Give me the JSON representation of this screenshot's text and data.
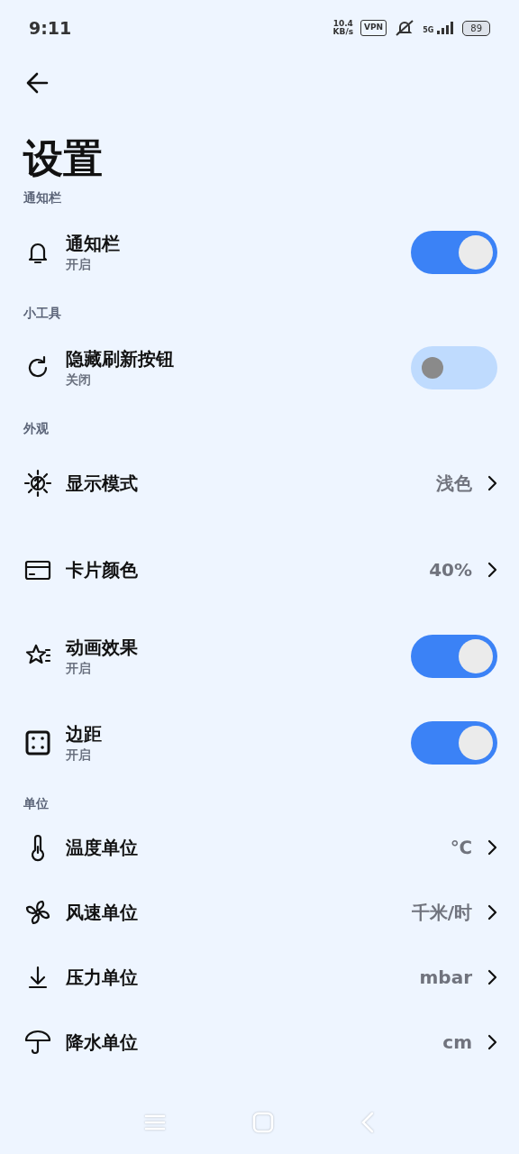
{
  "status_bar": {
    "time": "9:11",
    "net_speed": "10.4",
    "net_unit": "KB/s",
    "vpn": "VPN",
    "network": "5G",
    "battery": "89"
  },
  "title": "设置",
  "sections": [
    {
      "header": "通知栏",
      "items": [
        {
          "kind": "switch",
          "label": "通知栏",
          "sub": "开启",
          "on": true
        }
      ]
    },
    {
      "header": "小工具",
      "items": [
        {
          "kind": "switch",
          "label": "隐藏刷新按钮",
          "sub": "关闭",
          "on": false
        }
      ]
    },
    {
      "header": "外观",
      "items": [
        {
          "kind": "value",
          "label": "显示模式",
          "value": "浅色"
        },
        {
          "kind": "value",
          "label": "卡片颜色",
          "value": "40%"
        },
        {
          "kind": "switch",
          "label": "动画效果",
          "sub": "开启",
          "on": true
        },
        {
          "kind": "switch",
          "label": "边距",
          "sub": "开启",
          "on": true
        }
      ]
    },
    {
      "header": "单位",
      "items": [
        {
          "kind": "unit",
          "label": "温度单位",
          "value": "℃"
        },
        {
          "kind": "unit",
          "label": "风速单位",
          "value": "千米/时"
        },
        {
          "kind": "unit",
          "label": "压力单位",
          "value": "mbar"
        },
        {
          "kind": "unit",
          "label": "降水单位",
          "value": "cm"
        }
      ]
    }
  ]
}
